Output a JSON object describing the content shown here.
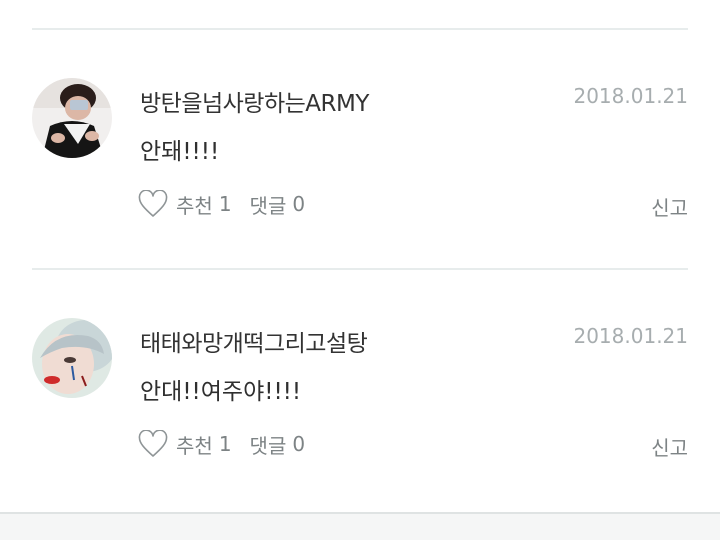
{
  "comments": [
    {
      "nickname": "방탄을넘사랑하는ARMY",
      "date": "2018.01.21",
      "content": "안돼!!!!",
      "like_label": "추천",
      "like_count": "1",
      "reply_label": "댓글",
      "reply_count": "0",
      "report_label": "신고",
      "avatar_icon": "avatar-photo-icon",
      "like_icon": "heart-outline-icon"
    },
    {
      "nickname": "태태와망개떡그리고설탕",
      "date": "2018.01.21",
      "content": "안대!!여주야!!!!",
      "like_label": "추천",
      "like_count": "1",
      "reply_label": "댓글",
      "reply_count": "0",
      "report_label": "신고",
      "avatar_icon": "avatar-photo-icon",
      "like_icon": "heart-outline-icon"
    }
  ],
  "colors": {
    "divider": "#e7ecec",
    "nickname": "#333333",
    "date": "#a7adaf",
    "action": "#7d8385"
  }
}
